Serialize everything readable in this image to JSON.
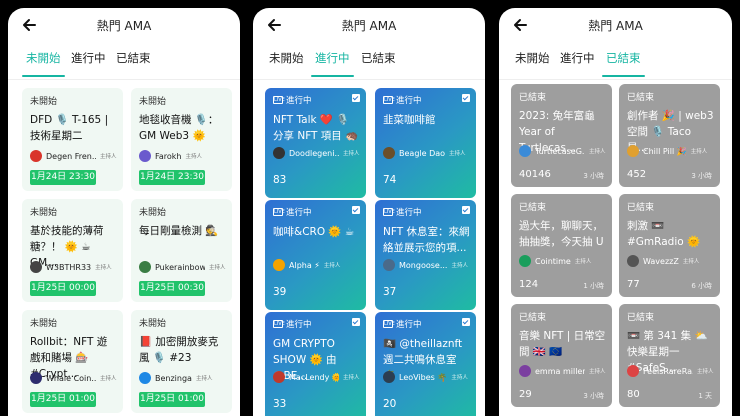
{
  "screens": [
    {
      "title": "熱門 AMA",
      "tabs": [
        "未開始",
        "進行中",
        "已結束"
      ],
      "active_tab": 0,
      "cards": [
        {
          "status": "未開始",
          "title": "DFD 🎙️ T-165 |技術星期二",
          "host": "Degen Fren...",
          "role": "主持人",
          "date": "1月24日 23:30",
          "avatar_color": "#d9352b"
        },
        {
          "status": "未開始",
          "title": "地毯收音機 🎙️：GM Web3 🌞",
          "host": "Farokh",
          "role": "主持人",
          "date": "1月24日 23:30",
          "avatar_color": "#6a5acd"
        },
        {
          "status": "未開始",
          "title": "基於技能的薄荷糖？！ 🌞 ☕ GM...",
          "host": "W3BTHR33",
          "role": "主持人",
          "date": "1月25日 00:00",
          "avatar_color": "#444"
        },
        {
          "status": "未開始",
          "title": "每日剛量檢測 🕵️",
          "host": "Pukerainbow",
          "role": "主持人",
          "date": "1月25日 00:30",
          "avatar_color": "#3a7d44"
        },
        {
          "status": "未開始",
          "title": "Rollbit：NFT 遊戲和賭場 🎰 #Crypt...",
          "host": "Whale Coin...",
          "role": "主持人",
          "date": "1月25日 01:00",
          "avatar_color": "#2d2d6e"
        },
        {
          "status": "未開始",
          "title": "📕 加密開放麥克風 🎙️ #23",
          "host": "Benzinga",
          "role": "主持人",
          "date": "1月25日 01:00",
          "avatar_color": "#1e88e5"
        }
      ]
    },
    {
      "title": "熱門 AMA",
      "tabs": [
        "未開始",
        "進行中",
        "已結束"
      ],
      "active_tab": 1,
      "cards": [
        {
          "status": "進行中",
          "live": "LIVE",
          "title": "NFT Talk ❤️ 🎙️ 分享 NFT 項目 🦔",
          "host": "Doodlegeni...",
          "role": "主持人",
          "count": "83",
          "avatar_color": "#333"
        },
        {
          "status": "進行中",
          "live": "LIVE",
          "title": "韭菜咖啡館",
          "host": "Beagle Dao",
          "role": "主持人",
          "count": "74",
          "avatar_color": "#6b4f2a"
        },
        {
          "status": "進行中",
          "live": "LIVE",
          "title": "咖啡&CRO 🌞 ☕",
          "host": "Alpha ⚡",
          "role": "主持人",
          "count": "39",
          "avatar_color": "#f4a300"
        },
        {
          "status": "進行中",
          "live": "LIVE",
          "title": "NFT 休息室：來網絡並展示您的項...",
          "host": "Mongoose...",
          "role": "主持人",
          "count": "37",
          "avatar_color": "#4a6a8a"
        },
        {
          "status": "進行中",
          "live": "LIVE",
          "title": "GM CRYPTO SHOW 🌞 由 @BE...",
          "host": "MacLendy 🌞",
          "role": "主持人",
          "count": "33",
          "avatar_color": "#c0392b"
        },
        {
          "status": "進行中",
          "live": "LIVE",
          "title": "🏴‍☠️ @theillaznft 週二共鳴休息室 🌴",
          "host": "LeoVibes 🌴",
          "role": "主持人",
          "count": "20",
          "avatar_color": "#2c3e50"
        }
      ]
    },
    {
      "title": "熱門 AMA",
      "tabs": [
        "未開始",
        "進行中",
        "已結束"
      ],
      "active_tab": 2,
      "cards": [
        {
          "status": "已結束",
          "title": "2023: 兔年富龜 Year of Turtlecas...",
          "host": "TurtlecaseG...",
          "role": "主持人",
          "count": "40146",
          "ago": "3 小時",
          "avatar_color": "#3b8bd8"
        },
        {
          "status": "已結束",
          "title": "創作者 🎉 | web3 空間 🎙️ Taco 星...",
          "host": "Chill Pill 🎉",
          "role": "主持人",
          "count": "452",
          "ago": "3 小時",
          "avatar_color": "#e0a030"
        },
        {
          "status": "已結束",
          "title": "過大年，聊聊天，抽抽獎，今天抽 U",
          "host": "Cointime",
          "role": "主持人",
          "count": "124",
          "ago": "1 小時",
          "avatar_color": "#1a9e5c"
        },
        {
          "status": "已結束",
          "title": "刺激 📼 #GmRadio 🌞",
          "host": "WavezzZ",
          "role": "主持人",
          "count": "77",
          "ago": "6 小時",
          "avatar_color": "#555"
        },
        {
          "status": "已結束",
          "title": "音樂 NFT | 日常空間 🇬🇧 🇪🇺",
          "host": "emma miller...",
          "role": "主持人",
          "count": "29",
          "ago": "3 小時",
          "avatar_color": "#7b3fa0"
        },
        {
          "status": "已結束",
          "title": "📼 第 341 集 ⛅ 快樂星期一 #SafeS...",
          "host": "FeelsRareRa...",
          "role": "主持人",
          "count": "80",
          "ago": "1 天",
          "avatar_color": "#d44"
        }
      ]
    }
  ]
}
